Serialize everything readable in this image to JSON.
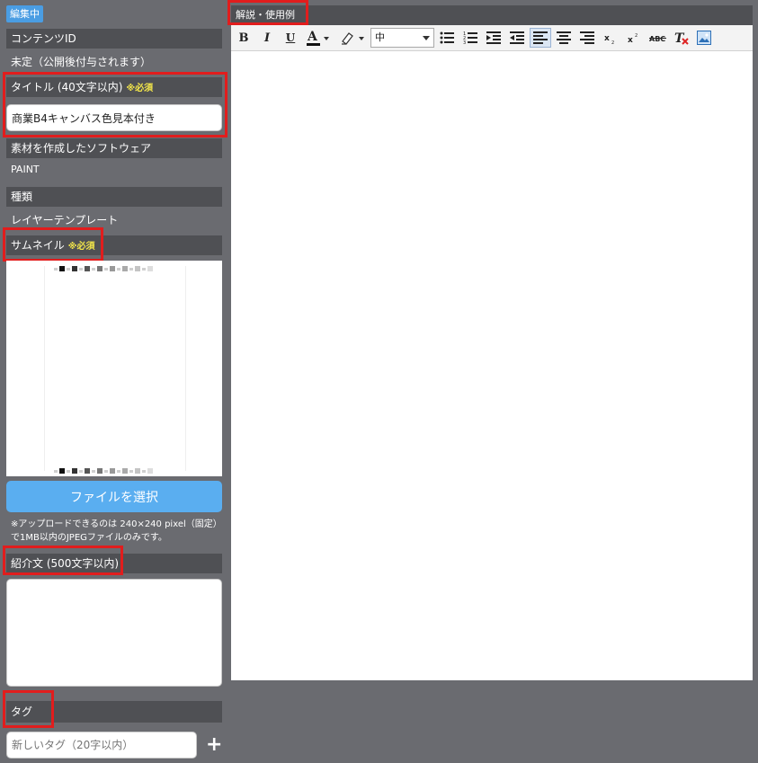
{
  "status_badge": "編集中",
  "content_id": {
    "label": "コンテンツID",
    "value": "未定（公開後付与されます）"
  },
  "title_field": {
    "label": "タイトル (40文字以内)",
    "required": "※必須",
    "value": "商業B4キャンバス色見本付き"
  },
  "software": {
    "label": "素材を作成したソフトウェア",
    "value": "PAINT"
  },
  "type": {
    "label": "種類",
    "value": "レイヤーテンプレート"
  },
  "thumbnail": {
    "label": "サムネイル",
    "required": "※必須"
  },
  "file_button": "ファイルを選択",
  "upload_note": "※アップロードできるのは 240×240 pixel（固定）で1MB以内のJPEGファイルのみです。",
  "intro": {
    "label": "紹介文 (500文字以内)",
    "value": ""
  },
  "tag": {
    "label": "タグ",
    "placeholder": "新しいタグ（20字以内）"
  },
  "editor": {
    "label": "解説・使用例",
    "font_size": "中",
    "icons": [
      "bold-icon",
      "italic-icon",
      "underline-icon",
      "font-color-icon",
      "highlight-icon",
      "bulleted-list-icon",
      "numbered-list-icon",
      "indent-icon",
      "outdent-icon",
      "align-left-icon",
      "align-center-icon",
      "align-right-icon",
      "subscript-icon",
      "superscript-icon",
      "strikethrough-icon",
      "clear-format-icon",
      "image-icon"
    ]
  },
  "colors": {
    "accent_blue": "#5aaef0",
    "required_yellow": "#f3e64a",
    "highlight_red": "#e11d1d",
    "header_gray": "#4f5054"
  }
}
